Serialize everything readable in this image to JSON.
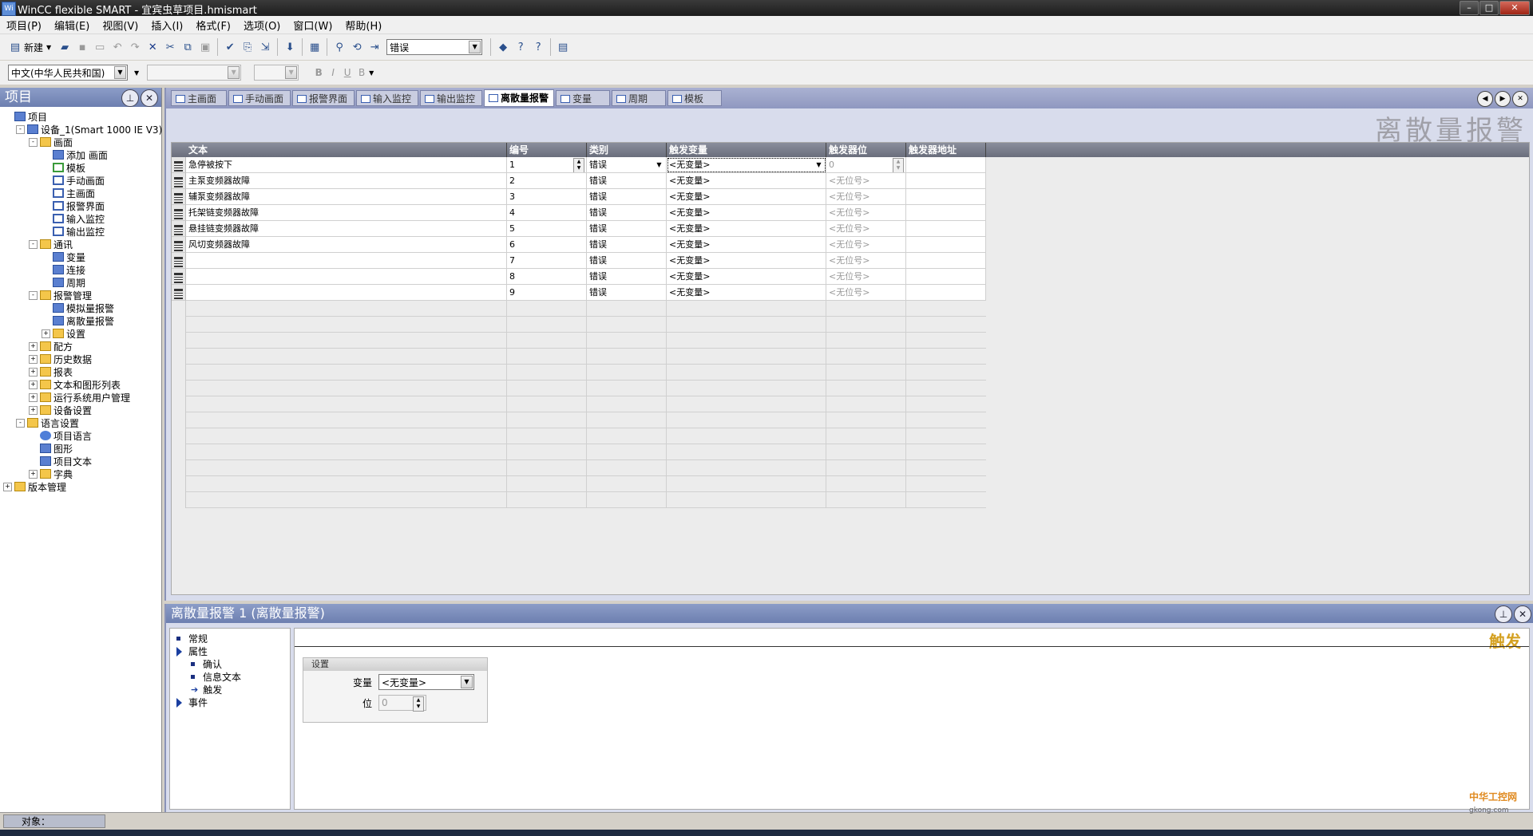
{
  "window": {
    "title": "WinCC flexible SMART - 宜宾虫草项目.hmismart",
    "icon_text": "Wi",
    "controls": [
      "minimize-icon",
      "maximize-icon",
      "close-icon"
    ]
  },
  "menu": [
    "项目(P)",
    "编辑(E)",
    "视图(V)",
    "插入(I)",
    "格式(F)",
    "选项(O)",
    "窗口(W)",
    "帮助(H)"
  ],
  "toolbar": {
    "new_label": "新建",
    "category_combo": "错误",
    "language_combo": "中文(中华人民共和国)",
    "format": [
      "B",
      "I",
      "U",
      "B"
    ]
  },
  "project_panel": {
    "title": "项目",
    "tree": [
      {
        "label": "项目",
        "level": 0,
        "icon": "project-icon"
      },
      {
        "label": "设备_1(Smart 1000 IE V3)",
        "level": 1,
        "exp": "-",
        "icon": "device-icon"
      },
      {
        "label": "画面",
        "level": 2,
        "exp": "-",
        "icon": "folder-icon"
      },
      {
        "label": "添加 画面",
        "level": 3,
        "icon": "add-screen-icon"
      },
      {
        "label": "模板",
        "level": 3,
        "icon": "template-icon"
      },
      {
        "label": "手动画面",
        "level": 3,
        "icon": "screen-icon"
      },
      {
        "label": "主画面",
        "level": 3,
        "icon": "screen-icon"
      },
      {
        "label": "报警界面",
        "level": 3,
        "icon": "screen-icon"
      },
      {
        "label": "输入监控",
        "level": 3,
        "icon": "screen-icon"
      },
      {
        "label": "输出监控",
        "level": 3,
        "icon": "screen-icon"
      },
      {
        "label": "通讯",
        "level": 2,
        "exp": "-",
        "icon": "folder-icon"
      },
      {
        "label": "变量",
        "level": 3,
        "icon": "tags-icon"
      },
      {
        "label": "连接",
        "level": 3,
        "icon": "connection-icon"
      },
      {
        "label": "周期",
        "level": 3,
        "icon": "cycle-icon"
      },
      {
        "label": "报警管理",
        "level": 2,
        "exp": "-",
        "icon": "folder-icon"
      },
      {
        "label": "模拟量报警",
        "level": 3,
        "icon": "analog-alarm-icon"
      },
      {
        "label": "离散量报警",
        "level": 3,
        "icon": "discrete-alarm-icon"
      },
      {
        "label": "设置",
        "level": 3,
        "exp": "+",
        "icon": "folder-icon"
      },
      {
        "label": "配方",
        "level": 2,
        "exp": "+",
        "icon": "folder-icon"
      },
      {
        "label": "历史数据",
        "level": 2,
        "exp": "+",
        "icon": "folder-icon"
      },
      {
        "label": "报表",
        "level": 2,
        "exp": "+",
        "icon": "folder-icon"
      },
      {
        "label": "文本和图形列表",
        "level": 2,
        "exp": "+",
        "icon": "folder-icon"
      },
      {
        "label": "运行系统用户管理",
        "level": 2,
        "exp": "+",
        "icon": "folder-icon"
      },
      {
        "label": "设备设置",
        "level": 2,
        "exp": "+",
        "icon": "folder-icon"
      },
      {
        "label": "语言设置",
        "level": 1,
        "exp": "-",
        "icon": "folder-icon"
      },
      {
        "label": "项目语言",
        "level": 2,
        "icon": "globe-icon"
      },
      {
        "label": "图形",
        "level": 2,
        "icon": "graphics-icon"
      },
      {
        "label": "项目文本",
        "level": 2,
        "icon": "text-icon"
      },
      {
        "label": "字典",
        "level": 2,
        "exp": "+",
        "icon": "folder-icon"
      },
      {
        "label": "版本管理",
        "level": 0,
        "exp": "+",
        "icon": "folder-icon"
      }
    ]
  },
  "editor": {
    "tabs": [
      "主画面",
      "手动画面",
      "报警界面",
      "输入监控",
      "输出监控",
      "离散量报警",
      "变量",
      "周期",
      "模板"
    ],
    "active_tab": 5,
    "big_title": "离散量报警",
    "columns": [
      "文本",
      "编号",
      "类别",
      "触发变量",
      "触发器位",
      "触发器地址"
    ],
    "rows": [
      {
        "text": "急停被按下",
        "num": "1",
        "cat": "错误",
        "var": "<无变量>",
        "bit": "0",
        "addr": ""
      },
      {
        "text": "主泵变频器故障",
        "num": "2",
        "cat": "错误",
        "var": "<无变量>",
        "bit": "<无位号>",
        "addr": ""
      },
      {
        "text": "辅泵变频器故障",
        "num": "3",
        "cat": "错误",
        "var": "<无变量>",
        "bit": "<无位号>",
        "addr": ""
      },
      {
        "text": "托架链变频器故障",
        "num": "4",
        "cat": "错误",
        "var": "<无变量>",
        "bit": "<无位号>",
        "addr": ""
      },
      {
        "text": "悬挂链变频器故障",
        "num": "5",
        "cat": "错误",
        "var": "<无变量>",
        "bit": "<无位号>",
        "addr": ""
      },
      {
        "text": "风切变频器故障",
        "num": "6",
        "cat": "错误",
        "var": "<无变量>",
        "bit": "<无位号>",
        "addr": ""
      },
      {
        "text": "",
        "num": "7",
        "cat": "错误",
        "var": "<无变量>",
        "bit": "<无位号>",
        "addr": ""
      },
      {
        "text": "",
        "num": "8",
        "cat": "错误",
        "var": "<无变量>",
        "bit": "<无位号>",
        "addr": ""
      },
      {
        "text": "",
        "num": "9",
        "cat": "错误",
        "var": "<无变量>",
        "bit": "<无位号>",
        "addr": ""
      }
    ]
  },
  "properties": {
    "title": "离散量报警 1 (离散量报警)",
    "nav": [
      {
        "label": "常规",
        "kind": "bullet",
        "indent": 0
      },
      {
        "label": "属性",
        "kind": "tri",
        "indent": 0
      },
      {
        "label": "确认",
        "kind": "bullet",
        "indent": 1
      },
      {
        "label": "信息文本",
        "kind": "bullet",
        "indent": 1
      },
      {
        "label": "触发",
        "kind": "arrow",
        "indent": 1
      },
      {
        "label": "事件",
        "kind": "tri",
        "indent": 0
      }
    ],
    "section_title": "触发",
    "settings_title": "设置",
    "var_label": "变量",
    "var_value": "<无变量>",
    "bit_label": "位",
    "bit_value": "0"
  },
  "status": {
    "object_label": "对象："
  },
  "watermark": {
    "main": "中华工控网",
    "sub": "gkong.com"
  }
}
